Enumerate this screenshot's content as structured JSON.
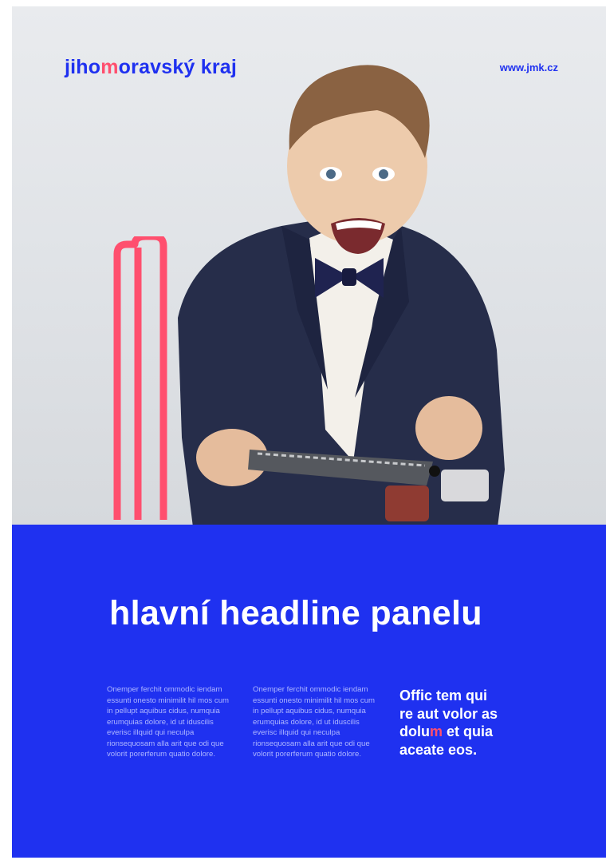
{
  "brand": {
    "logo_before": "jiho",
    "logo_accent": "m",
    "logo_after": "oravský kraj",
    "url": "www.jmk.cz",
    "blue": "#1f31f0",
    "accent": "#ff4f6e"
  },
  "panel": {
    "headline": "hlavní headline panelu",
    "column1": "Onemper ferchit ommodic iendam essunti onesto minimilit hil mos cum in pellupt aquibus cidus, numquia erumquias dolore, id ut iduscilis everisc illquid qui neculpa rionsequosam alla arit que odi que volorit porerferum quatio dolore.",
    "column2": "Onemper ferchit ommodic iendam essunti onesto minimilit hil mos cum in pellupt aquibus cidus, numquia erumquias dolore, id ut iduscilis everisc illquid qui neculpa rionsequosam alla arit que odi que volorit porerferum quatio dolore.",
    "quote_line1": "Offic tem qui",
    "quote_line2": "re aut volor as",
    "quote_line3_before": "dolu",
    "quote_line3_accent": "m",
    "quote_line3_after": " et quia",
    "quote_line4": "aceate eos."
  }
}
